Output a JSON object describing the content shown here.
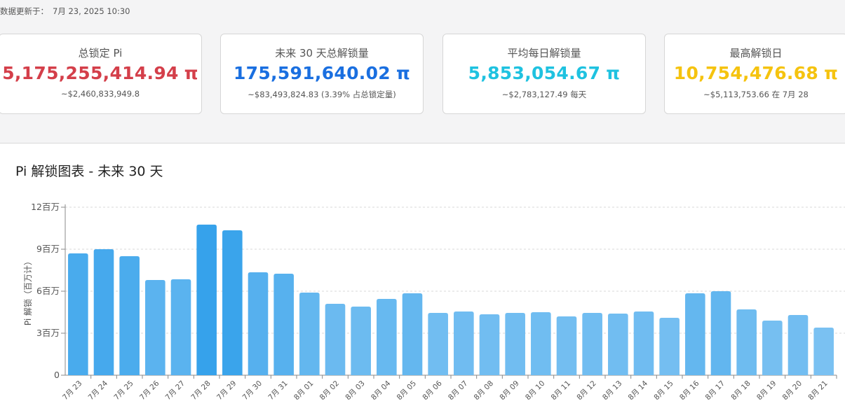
{
  "header": {
    "updated_label": "数据更新于：",
    "updated_value": "7月 23, 2025 10:30"
  },
  "cards": [
    {
      "label": "总锁定 Pi",
      "value": "5,175,255,414.94",
      "unit": "π",
      "sub": "~$2,460,833,949.8",
      "color": "#d43f4a"
    },
    {
      "label": "未来 30 天总解锁量",
      "value": "175,591,640.02",
      "unit": "π",
      "sub": "~$83,493,824.83 (3.39% 占总锁定量)",
      "color": "#1a6fe0"
    },
    {
      "label": "平均每日解锁量",
      "value": "5,853,054.67",
      "unit": "π",
      "sub": "~$2,783,127.49 每天",
      "color": "#1fc2e0"
    },
    {
      "label": "最高解锁日",
      "value": "10,754,476.68",
      "unit": "π",
      "sub": "~$5,113,753.66 在 7月 28",
      "color": "#f5c30f"
    }
  ],
  "chart_data": {
    "type": "bar",
    "title": "Pi 解锁图表 - 未来 30 天",
    "ylabel": "Pi 解锁（百万计）",
    "xlabel": "",
    "ylim": [
      0,
      12000000
    ],
    "yticks": [
      0,
      3000000,
      6000000,
      9000000,
      12000000
    ],
    "ytick_labels": [
      "0",
      "3百万",
      "6百万",
      "9百万",
      "12百万"
    ],
    "grid": true,
    "categories": [
      "7月 23",
      "7月 24",
      "7月 25",
      "7月 26",
      "7月 27",
      "7月 28",
      "7月 29",
      "7月 30",
      "7月 31",
      "8月 01",
      "8月 02",
      "8月 03",
      "8月 04",
      "8月 05",
      "8月 06",
      "8月 07",
      "8月 08",
      "8月 09",
      "8月 10",
      "8月 11",
      "8月 12",
      "8月 13",
      "8月 14",
      "8月 15",
      "8月 16",
      "8月 17",
      "8月 18",
      "8月 19",
      "8月 20",
      "8月 21"
    ],
    "values": [
      8700000,
      9000000,
      8500000,
      6800000,
      6850000,
      10754476.68,
      10350000,
      7350000,
      7250000,
      5900000,
      5100000,
      4900000,
      5450000,
      5850000,
      4450000,
      4550000,
      4350000,
      4450000,
      4500000,
      4200000,
      4450000,
      4400000,
      4550000,
      4100000,
      5850000,
      6000000,
      4700000,
      3900000,
      4300000,
      3400000
    ],
    "colors": {
      "high": "#36a2eb",
      "low": "#7ec3f2",
      "grid": "#d8d8d8",
      "axis": "#888888",
      "text": "#555555"
    }
  }
}
